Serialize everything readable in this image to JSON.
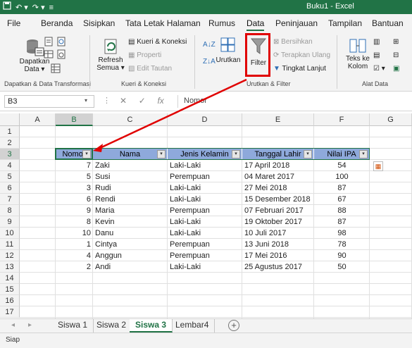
{
  "window": {
    "title": "Buku1 - Excel"
  },
  "menu": {
    "tabs": [
      "File",
      "Beranda",
      "Sisipkan",
      "Tata Letak Halaman",
      "Rumus",
      "Data",
      "Peninjauan",
      "Tampilan",
      "Bantuan"
    ],
    "active": "Data"
  },
  "ribbon": {
    "get_data": {
      "label_line1": "Dapatkan",
      "label_line2": "Data",
      "group": "Dapatkan & Data Transformasi"
    },
    "queries": {
      "refresh_line1": "Refresh",
      "refresh_line2": "Semua",
      "kueri": "Kueri & Koneksi",
      "properti": "Properti",
      "edit_tautan": "Edit Tautan",
      "group": "Kueri & Koneksi"
    },
    "sort_filter": {
      "urutkan": "Urutkan",
      "filter": "Filter",
      "bersihkan": "Bersihkan",
      "terapkan": "Terapkan Ulang",
      "tingkat": "Tingkat Lanjut",
      "group": "Urutkan & Filter"
    },
    "data_tools": {
      "teks_line1": "Teks ke",
      "teks_line2": "Kolom",
      "group": "Alat Data"
    }
  },
  "formula_bar": {
    "name_box": "B3",
    "fx": "fx",
    "value": "Nomor"
  },
  "columns": [
    "A",
    "B",
    "C",
    "D",
    "E",
    "F",
    "G"
  ],
  "rows": [
    "1",
    "2",
    "3",
    "4",
    "5",
    "6",
    "7",
    "8",
    "9",
    "10",
    "11",
    "12",
    "13",
    "14",
    "15",
    "16",
    "17"
  ],
  "table": {
    "headers": [
      "Nomor",
      "Nama",
      "Jenis Kelamin",
      "Tanggal Lahir",
      "Nilai IPA"
    ],
    "rows": [
      [
        "7",
        "Zaki",
        "Laki-Laki",
        "17 April 2018",
        "54"
      ],
      [
        "5",
        "Susi",
        "Perempuan",
        "04 Maret 2017",
        "100"
      ],
      [
        "3",
        "Rudi",
        "Laki-Laki",
        "27 Mei 2018",
        "87"
      ],
      [
        "6",
        "Rendi",
        "Laki-Laki",
        "15 Desember 2018",
        "67"
      ],
      [
        "9",
        "Maria",
        "Perempuan",
        "07 Februari 2017",
        "88"
      ],
      [
        "8",
        "Kevin",
        "Laki-Laki",
        "19 Oktober 2017",
        "87"
      ],
      [
        "10",
        "Danu",
        "Laki-Laki",
        "10 Juli 2017",
        "98"
      ],
      [
        "1",
        "Cintya",
        "Perempuan",
        "13 Juni 2018",
        "78"
      ],
      [
        "4",
        "Anggun",
        "Perempuan",
        "17 Mei 2016",
        "90"
      ],
      [
        "2",
        "Andi",
        "Laki-Laki",
        "25 Agustus 2017",
        "50"
      ]
    ]
  },
  "sheets": {
    "tabs": [
      "Siswa 1",
      "Siswa 2",
      "Siswa 3",
      "Lembar4"
    ],
    "active": "Siswa 3",
    "add": "+"
  },
  "status": {
    "text": "Siap"
  },
  "colors": {
    "accent": "#217346",
    "header_fill": "#8ea9db",
    "annotation": "#e00000"
  }
}
